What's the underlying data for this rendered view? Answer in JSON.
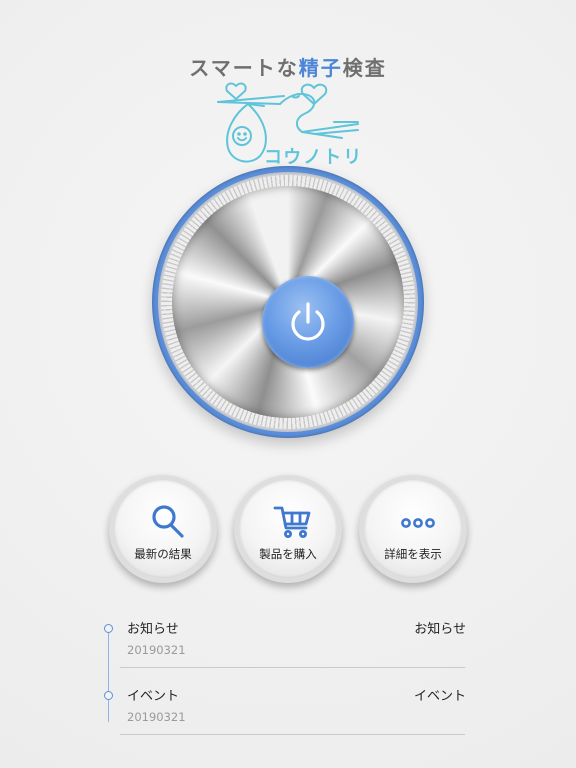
{
  "header": {
    "tagline_pre": "スマートな",
    "tagline_highlight": "精子",
    "tagline_post": "検査",
    "logo_text": "コウノトリ",
    "logo_alt": "stork-carrying-baby-logo"
  },
  "power": {
    "icon": "power-icon"
  },
  "actions": [
    {
      "label": "最新の結果",
      "icon": "search-icon"
    },
    {
      "label": "製品を購入",
      "icon": "cart-icon"
    },
    {
      "label": "詳細を表示",
      "icon": "more-dots-icon"
    }
  ],
  "news": [
    {
      "title": "お知らせ",
      "category": "お知らせ",
      "date": "20190321"
    },
    {
      "title": "イベント",
      "category": "イベント",
      "date": "20190321"
    }
  ],
  "colors": {
    "accent": "#5b8fdb",
    "logo": "#5fc4d9",
    "tagline": "#6f6f6f"
  }
}
